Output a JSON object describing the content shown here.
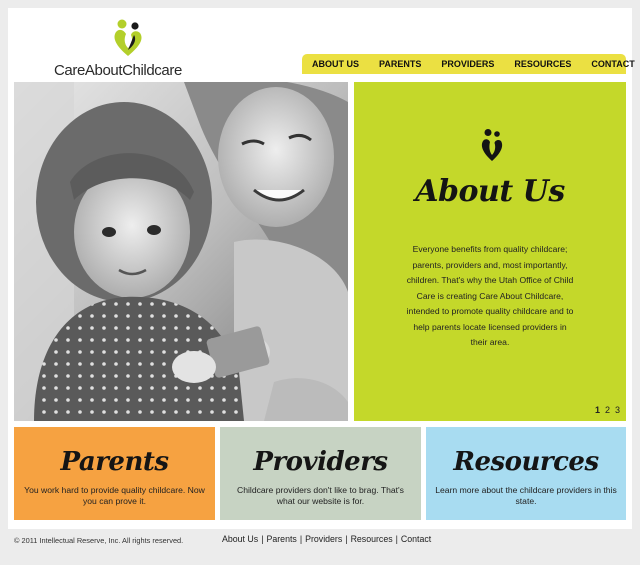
{
  "header": {
    "logo_text_part1": "Care",
    "logo_text_part2": "About",
    "logo_text_part3": "Childcare"
  },
  "nav": {
    "items": [
      "ABOUT US",
      "PARENTS",
      "PROVIDERS",
      "RESOURCES",
      "CONTACT"
    ]
  },
  "about": {
    "title": "About Us",
    "body": "Everyone benefits from quality childcare; parents, providers and, most importantly, children. That's why the Utah Office of Child Care is creating Care About Childcare, intended to promote quality childcare and to help parents locate licensed providers in their area.",
    "pages": [
      "1",
      "2",
      "3"
    ]
  },
  "cards": {
    "parents": {
      "title": "Parents",
      "text": "You work hard to provide quality childcare. Now you can prove it."
    },
    "providers": {
      "title": "Providers",
      "text": "Childcare providers don't like to brag. That's what our website is for."
    },
    "resources": {
      "title": "Resources",
      "text": "Learn more about the childcare providers in this state."
    }
  },
  "footer": {
    "copyright": "© 2011 Intellectual Reserve, Inc. All rights reserved.",
    "links": [
      "About Us",
      "Parents",
      "Providers",
      "Resources",
      "Contact"
    ],
    "separator": "|"
  },
  "colors": {
    "nav_bar": "#ebe042",
    "about_panel": "#c4d82a",
    "parents_card": "#f6a241",
    "providers_card": "#c7d3c3",
    "resources_card": "#a8dcf1",
    "logo_green": "#b3cf2a",
    "logo_dark": "#1a1a1a"
  },
  "icons": {
    "logo_mark": "heart-figures-icon",
    "about_mark": "heart-figures-icon"
  }
}
